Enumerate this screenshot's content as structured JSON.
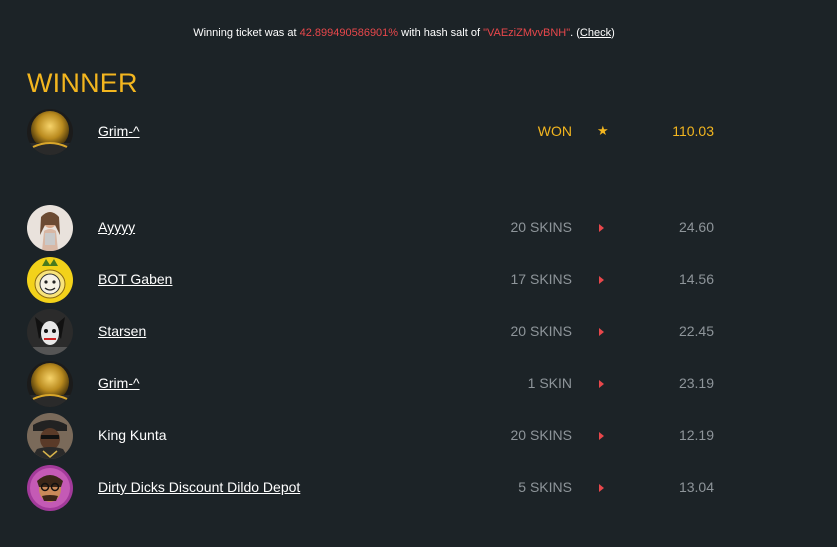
{
  "header": {
    "ticket_prefix": "Winning ticket was at ",
    "ticket_value": "42.899490586901%",
    "salt_prefix": " with hash salt of ",
    "salt_value": "\"VAEziZMvvBNH\"",
    "check_open": ". (",
    "check_label": "Check",
    "check_close": ")"
  },
  "winner": {
    "title": "WINNER",
    "name": "Grim-^",
    "status": "WON",
    "marker": "star",
    "amount": "110.03"
  },
  "players": [
    {
      "name": "Ayyyy",
      "skins": "20 SKINS",
      "amount": "24.60",
      "linked": true
    },
    {
      "name": "BOT Gaben",
      "skins": "17 SKINS",
      "amount": "14.56",
      "linked": true
    },
    {
      "name": "Starsen",
      "skins": "20 SKINS",
      "amount": "22.45",
      "linked": true
    },
    {
      "name": "Grim-^",
      "skins": "1 SKIN",
      "amount": "23.19",
      "linked": true
    },
    {
      "name": "King Kunta",
      "skins": "20 SKINS",
      "amount": "12.19",
      "linked": false
    },
    {
      "name": "Dirty Dicks Discount Dildo Depot",
      "skins": "5 SKINS",
      "amount": "13.04",
      "linked": true
    }
  ],
  "colors": {
    "background": "#1c2327",
    "accent_gold": "#f3b61f",
    "accent_red": "#e8474b",
    "muted": "#8e959a"
  }
}
